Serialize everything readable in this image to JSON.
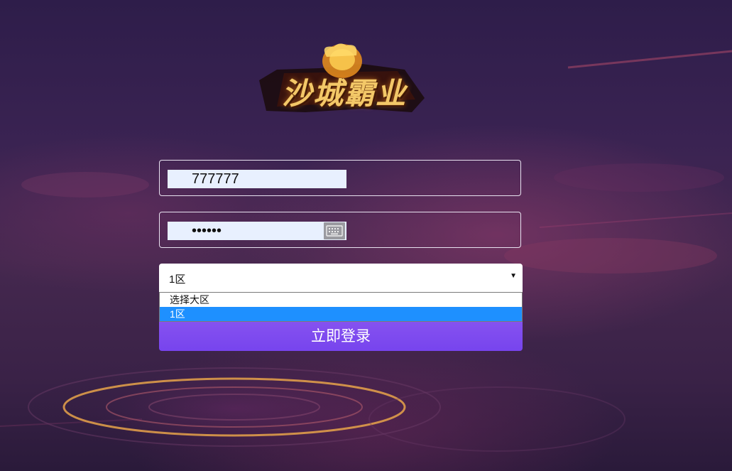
{
  "logo": {
    "title": "沙城霸业"
  },
  "login_form": {
    "username_value": "777777",
    "password_value": "••••••",
    "server_select": {
      "selected_value": "1区",
      "options": [
        "选择大区",
        "1区"
      ]
    },
    "login_button_label": "立即登录"
  },
  "colors": {
    "accent": "#7744ee",
    "option_highlight": "#1e90ff",
    "input_bg": "#e8f0fe"
  }
}
